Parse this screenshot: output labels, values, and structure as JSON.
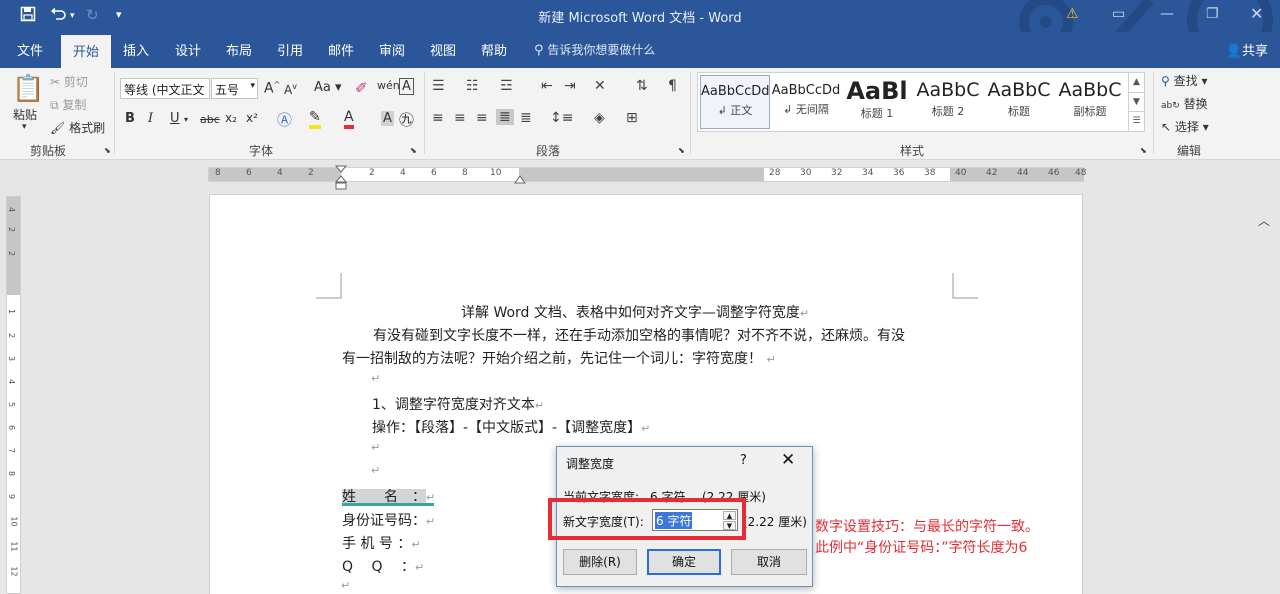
{
  "titlebar": {
    "title": "新建 Microsoft Word 文档 - Word",
    "save_icon": "save-icon",
    "undo_icon": "undo-icon",
    "redo_icon": "redo-icon"
  },
  "tabs": [
    "文件",
    "开始",
    "插入",
    "设计",
    "布局",
    "引用",
    "邮件",
    "审阅",
    "视图",
    "帮助"
  ],
  "active_tab": "开始",
  "tellme": "告诉我你想要做什么",
  "share": "共享",
  "clipboard": {
    "paste": "粘贴",
    "cut": "剪切",
    "copy": "复制",
    "format_painter": "格式刷",
    "label": "剪贴板"
  },
  "font": {
    "name": "等线 (中文正文",
    "size": "五号",
    "label": "字体",
    "bold": "B",
    "italic": "I",
    "underline": "U",
    "strike": "abc",
    "sub": "x₂",
    "sup": "x²",
    "grow": "A",
    "shrink": "A",
    "case": "Aa",
    "phonetic": "wén",
    "border_char": "A",
    "color_a": "A"
  },
  "paragraph": {
    "label": "段落"
  },
  "styles": {
    "label": "样式",
    "items": [
      {
        "preview": "AaBbCcDd",
        "name": "正文"
      },
      {
        "preview": "AaBbCcDd",
        "name": "无间隔"
      },
      {
        "preview": "AaBl",
        "name": "标题 1"
      },
      {
        "preview": "AaBbC",
        "name": "标题 2"
      },
      {
        "preview": "AaBbC",
        "name": "标题"
      },
      {
        "preview": "AaBbC",
        "name": "副标题"
      }
    ]
  },
  "editing": {
    "label": "编辑",
    "find": "查找",
    "replace": "替换",
    "select": "选择"
  },
  "ruler": {
    "left_nums": [
      "8",
      "6",
      "4",
      "2",
      "2",
      "4",
      "6",
      "8",
      "10"
    ],
    "right_nums": [
      "28",
      "30",
      "32",
      "34",
      "36",
      "38",
      "40",
      "42",
      "44",
      "46",
      "48"
    ],
    "vnums": [
      "4",
      "2",
      "2",
      "1",
      "2",
      "3",
      "4",
      "5",
      "6",
      "7",
      "8",
      "9",
      "10",
      "11",
      "12"
    ]
  },
  "document": {
    "title": "详解 Word 文档、表格中如何对齐文字—调整字符宽度",
    "p1_line1": "有没有碰到文字长度不一样，还在手动添加空格的事情呢？对不齐不说，还麻烦。有没",
    "p1_line2": "有一招制敌的方法呢？开始介绍之前，先记住一个词儿：字符宽度！",
    "h1": "1、调整字符宽度对齐文本",
    "op": "操作：【段落】-【中文版式】-【调整宽度】",
    "f_name": "姓　　名　：",
    "f_id": "身份证号码：",
    "f_phone": "手 机 号 ：",
    "f_qq": "Q　 Q　 ：",
    "para_mark": "↵"
  },
  "dialog": {
    "title": "调整宽度",
    "help": "?",
    "current_label": "当前文字宽度:",
    "current_value": "6 字符",
    "current_cm": "(2.22 厘米)",
    "new_label": "新文字宽度(T):",
    "new_value": "6 字符",
    "new_cm": "(2.22 厘米)",
    "delete": "删除(R)",
    "ok": "确定",
    "cancel": "取消"
  },
  "annotation": {
    "line1": "数字设置技巧：与最长的字符一致。",
    "line2": "此例中“身份证号码：”字符长度为6"
  },
  "colors": {
    "brand": "#2b579a",
    "annotation": "#e62c34",
    "selection": "#3b78d8",
    "teal_underline": "#35a6a0"
  }
}
